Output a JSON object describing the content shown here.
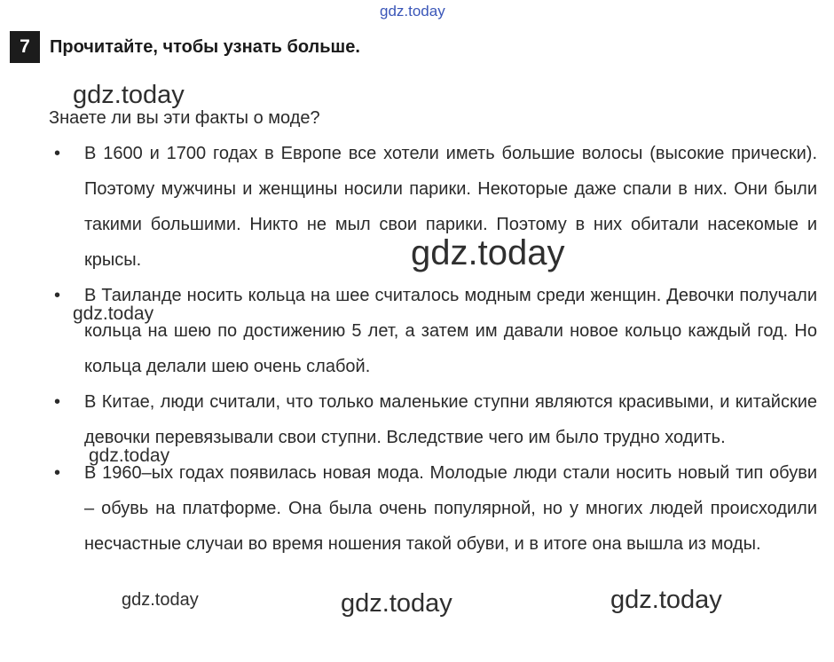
{
  "exercise": {
    "number": "7",
    "title": "Прочитайте, чтобы узнать больше."
  },
  "intro": "Знаете ли вы эти факты о моде?",
  "facts": [
    {
      "bullet": "•",
      "text": "В 1600 и 1700 годах в Европе все хотели иметь большие волосы (высокие прически). Поэтому мужчины и женщины носили парики. Некоторые даже спали в них. Они были такими большими. Никто не мыл свои парики. Поэтому в них обитали насекомые и крысы."
    },
    {
      "bullet": "•",
      "text": "В Таиланде носить кольца на шее считалось модным среди женщин. Девочки получали кольца на шею по достижению 5 лет, а затем им давали новое кольцо каждый год. Но кольца делали шею очень слабой."
    },
    {
      "bullet": "•",
      "text": "В Китае, люди считали, что только маленькие ступни являются красивыми, и китайские девочки перевязывали свои ступни. Вследствие чего им было трудно ходить."
    },
    {
      "bullet": "•",
      "text": "В 1960–ых годах появилась новая мода. Молодые люди стали носить новый тип обуви – обувь на платформе. Она была очень популярной, но у многих людей происходили несчастные случаи во время ношения такой обуви, и в итоге она вышла из моды."
    }
  ],
  "watermarks": {
    "top": "gdz.today",
    "w1": "gdz.today",
    "w2": "gdz.today",
    "w3": "gdz.today",
    "w4": "gdz.today",
    "w5": "gdz.today",
    "w6": "gdz.today",
    "w7": "gdz.today"
  },
  "colors": {
    "text": "#2a2a2a",
    "badge": "#1c1c1c",
    "watermark_top": "#3a56b8"
  }
}
